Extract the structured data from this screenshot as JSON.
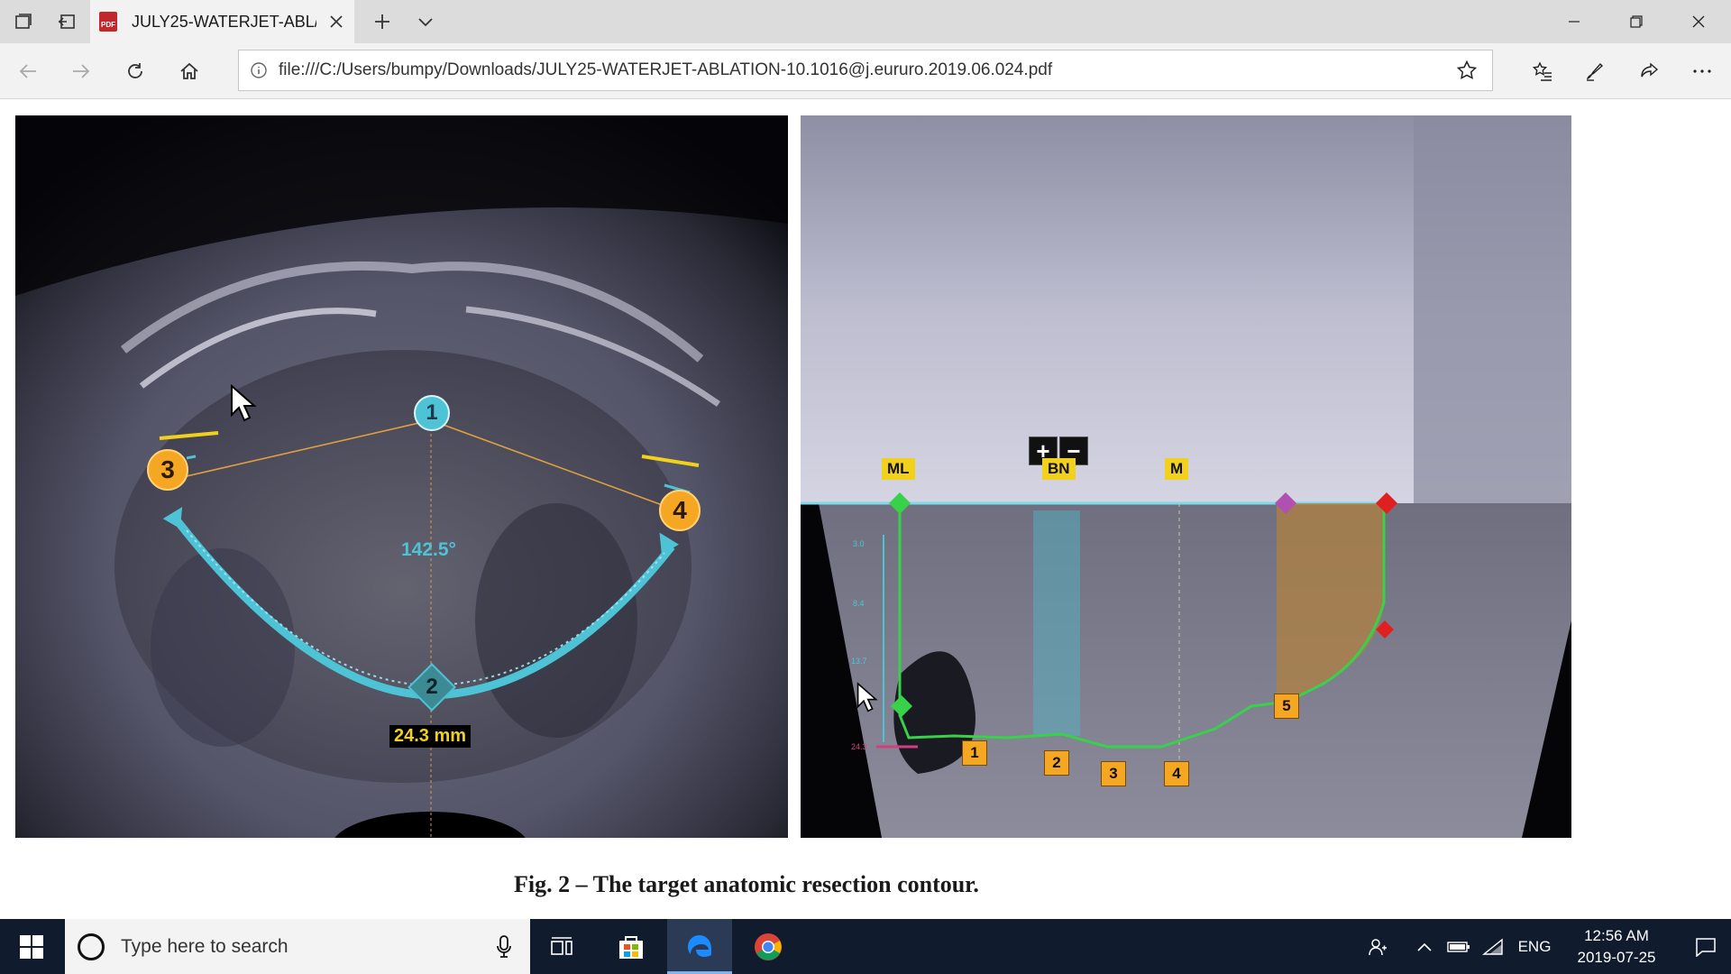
{
  "browser": {
    "tab": {
      "icon": "pdf-icon",
      "title": "JULY25-WATERJET-ABLATION-10.1016@j.eururo.2019.06.024.pdf",
      "short_title": "JULY25-WATERJET-ABL/"
    },
    "address_bar": {
      "url": "file:///C:/Users/bumpy/Downloads/JULY25-WATERJET-ABLATION-10.1016@j.eururo.2019.06.024.pdf"
    },
    "toolbar_icons": [
      "tab-previews-icon",
      "set-aside-tabs-icon",
      "new-tab-icon",
      "tab-list-icon",
      "back-icon",
      "forward-icon",
      "refresh-icon",
      "home-icon",
      "info-icon",
      "favorite-star-icon",
      "favorites-list-icon",
      "add-notes-icon",
      "share-icon",
      "more-icon",
      "minimize-icon",
      "restore-icon",
      "close-icon"
    ]
  },
  "document": {
    "left_figure": {
      "markers": [
        "1",
        "2",
        "3",
        "4"
      ],
      "angle_label": "142.5°",
      "distance_label": "24.3 mm"
    },
    "right_figure": {
      "zoom_buttons": [
        "+",
        "−"
      ],
      "top_labels": [
        "ML",
        "BN",
        "M"
      ],
      "step_markers": [
        "1",
        "2",
        "3",
        "4",
        "5"
      ],
      "scale_ticks": [
        "3.0",
        "8.4",
        "13.7",
        "24.3"
      ]
    },
    "caption": "Fig. 2 – The target anatomic resection contour."
  },
  "taskbar": {
    "search_placeholder": "Type here to search",
    "apps": [
      "task-view-icon",
      "store-icon",
      "edge-icon",
      "chrome-icon"
    ],
    "tray": {
      "language": "ENG",
      "time": "12:56 AM",
      "date": "2019-07-25"
    }
  },
  "colors": {
    "accent_cyan": "#4fc3d6",
    "marker_orange": "#f5a623",
    "label_yellow": "#f2d11c",
    "contour_green": "#38d14a",
    "taskbar": "#101b2e"
  }
}
